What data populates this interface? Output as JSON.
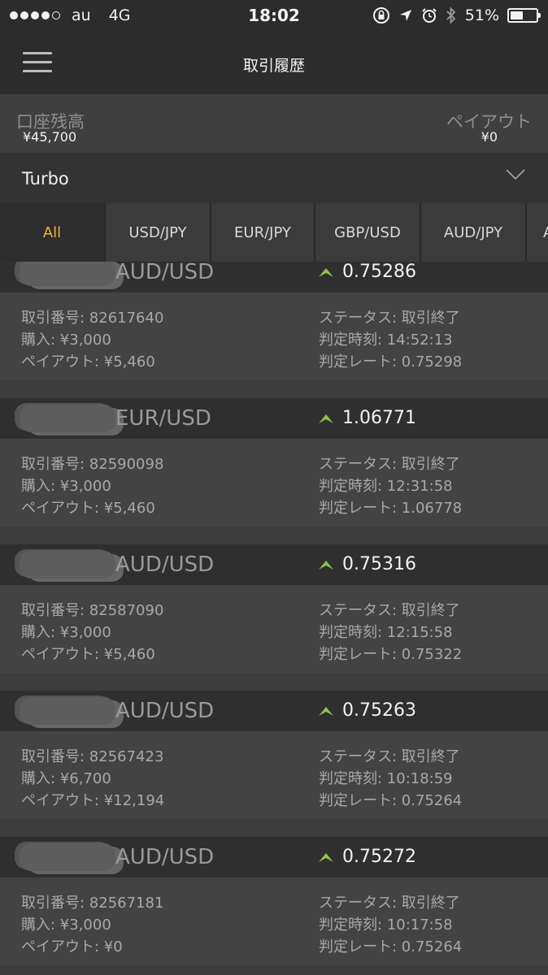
{
  "status_bar": {
    "carrier": "au",
    "network": "4G",
    "time": "18:02",
    "battery": "51%",
    "battery_level": 0.51,
    "icons": [
      "orientation-lock-icon",
      "location-icon",
      "alarm-icon",
      "bluetooth-icon"
    ]
  },
  "header": {
    "title": "取引履歴",
    "menu_icon": "hamburger-menu-icon"
  },
  "balance": {
    "account_label": "口座残高",
    "account_value": "¥45,700",
    "payout_label": "ペイアウト",
    "payout_value": "¥0"
  },
  "selector": {
    "label": "Turbo",
    "icon": "chevron-down-icon"
  },
  "tabs": [
    {
      "label": "All",
      "active": true
    },
    {
      "label": "USD/JPY",
      "active": false
    },
    {
      "label": "EUR/JPY",
      "active": false
    },
    {
      "label": "GBP/USD",
      "active": false
    },
    {
      "label": "AUD/JPY",
      "active": false
    },
    {
      "label": "A",
      "active": false
    }
  ],
  "trades": [
    {
      "pair": "AUD/USD",
      "rate": "0.75286",
      "id": "取引番号: 82617640",
      "purchase": "購入: ¥3,000",
      "payout": "ペイアウト: ¥5,460",
      "status": "ステータス: 取引終了",
      "time": "判定時刻: 14:52:13",
      "judge_rate": "判定レート: 0.75298"
    },
    {
      "pair": "EUR/USD",
      "rate": "1.06771",
      "id": "取引番号: 82590098",
      "purchase": "購入: ¥3,000",
      "payout": "ペイアウト: ¥5,460",
      "status": "ステータス: 取引終了",
      "time": "判定時刻: 12:31:58",
      "judge_rate": "判定レート: 1.06778"
    },
    {
      "pair": "AUD/USD",
      "rate": "0.75316",
      "id": "取引番号: 82587090",
      "purchase": "購入: ¥3,000",
      "payout": "ペイアウト: ¥5,460",
      "status": "ステータス: 取引終了",
      "time": "判定時刻: 12:15:58",
      "judge_rate": "判定レート: 0.75322"
    },
    {
      "pair": "AUD/USD",
      "rate": "0.75263",
      "id": "取引番号: 82567423",
      "purchase": "購入: ¥6,700",
      "payout": "ペイアウト: ¥12,194",
      "status": "ステータス: 取引終了",
      "time": "判定時刻: 10:18:59",
      "judge_rate": "判定レート: 0.75264"
    },
    {
      "pair": "AUD/USD",
      "rate": "0.75272",
      "id": "取引番号: 82567181",
      "purchase": "購入: ¥3,000",
      "payout": "ペイアウト: ¥0",
      "status": "ステータス: 取引終了",
      "time": "判定時刻: 10:17:58",
      "judge_rate": "判定レート: 0.75264"
    }
  ],
  "colors": {
    "accent_tab": "#e8b33d",
    "up_arrow": "#8bc34a",
    "header_bg": "#2c2c2c"
  }
}
